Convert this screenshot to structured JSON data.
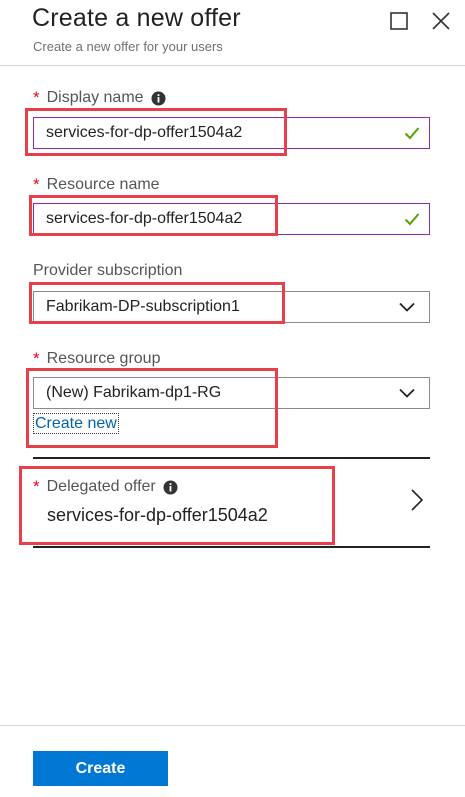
{
  "header": {
    "title": "Create a new offer",
    "subtitle": "Create a new offer for your users"
  },
  "form": {
    "display_name": {
      "label": "Display name",
      "value": "services-for-dp-offer1504a2",
      "required": true,
      "has_info": true,
      "valid": true
    },
    "resource_name": {
      "label": "Resource name",
      "value": "services-for-dp-offer1504a2",
      "required": true,
      "valid": true
    },
    "provider_subscription": {
      "label": "Provider subscription",
      "selected": "Fabrikam-DP-subscription1"
    },
    "resource_group": {
      "label": "Resource group",
      "selected": "(New) Fabrikam-dp1-RG",
      "required": true,
      "create_new_link": "Create new"
    },
    "delegated_offer": {
      "label": "Delegated offer",
      "value": "services-for-dp-offer1504a2",
      "required": true,
      "has_info": true
    }
  },
  "footer": {
    "create_label": "Create"
  },
  "colors": {
    "accent": "#0078d4",
    "required": "#e00b1c",
    "valid_check": "#57a300",
    "input_border": "#8e2bb0",
    "highlight": "#e8404a"
  },
  "icons": [
    "maximize-icon",
    "close-icon",
    "info-icon",
    "checkmark-icon",
    "chevron-down-icon",
    "chevron-right-icon"
  ]
}
